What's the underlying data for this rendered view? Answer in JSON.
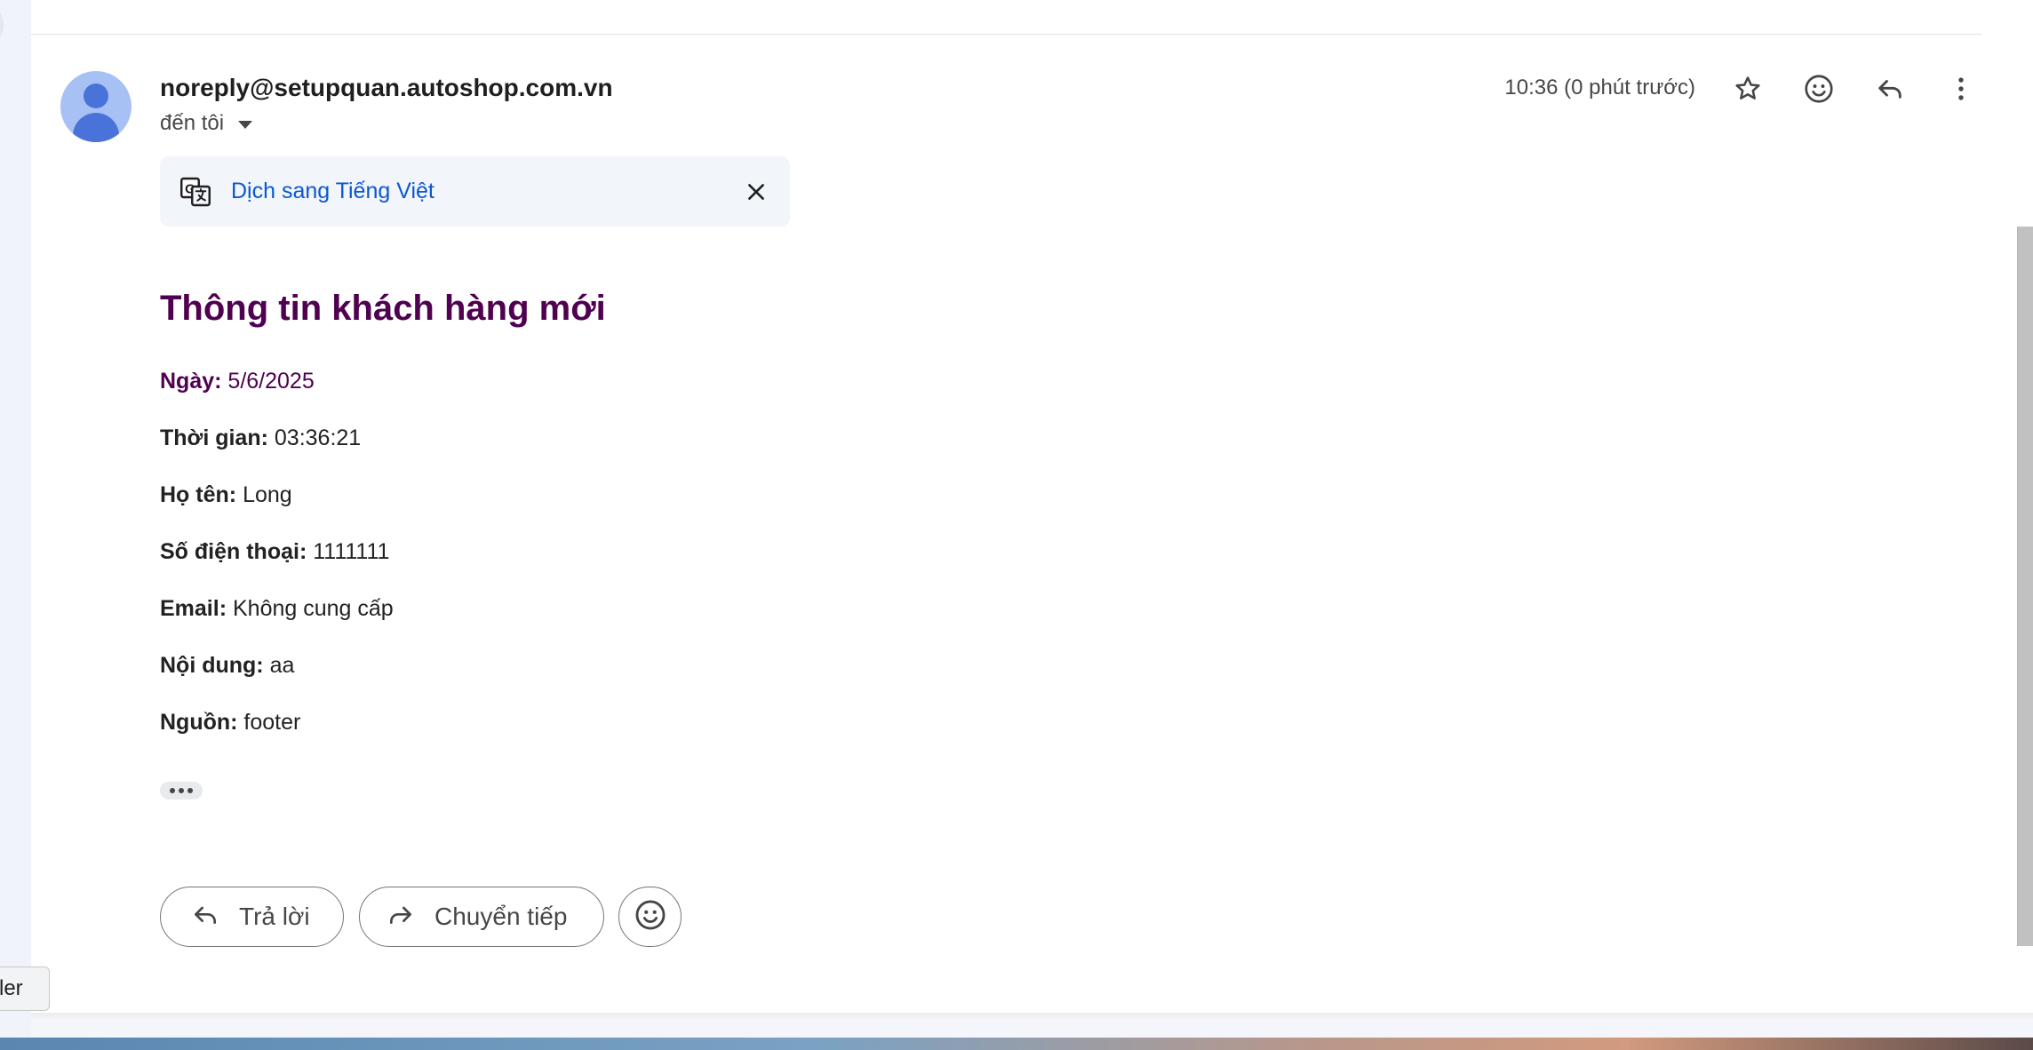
{
  "email": {
    "sender": "noreply@setupquan.autoshop.com.vn",
    "recipient_label": "đến tôi",
    "timestamp": "10:36 (0 phút trước)"
  },
  "translate_bar": {
    "link_label": "Dịch sang Tiếng Việt"
  },
  "message": {
    "title": "Thông tin khách hàng mới",
    "fields": [
      {
        "label": "Ngày:",
        "value": "5/6/2025"
      },
      {
        "label": "Thời gian:",
        "value": "03:36:21"
      },
      {
        "label": "Họ tên:",
        "value": "Long"
      },
      {
        "label": "Số điện thoại:",
        "value": "1111111"
      },
      {
        "label": "Email:",
        "value": "Không cung cấp"
      },
      {
        "label": "Nội dung:",
        "value": "aa"
      },
      {
        "label": "Nguồn:",
        "value": "footer"
      }
    ]
  },
  "actions": {
    "reply_label": "Trả lời",
    "forward_label": "Chuyển tiếp"
  },
  "tooltip": {
    "text": "ler"
  },
  "icons": [
    "translate-icon",
    "close-icon",
    "star-icon",
    "emoji-icon",
    "reply-icon",
    "more-vert-icon",
    "forward-icon",
    "chevron-down-icon"
  ],
  "colors": {
    "title": "#500050",
    "link": "#0b57d0",
    "avatar_bg": "#a8c1f5",
    "avatar_fg": "#4a73d9"
  }
}
